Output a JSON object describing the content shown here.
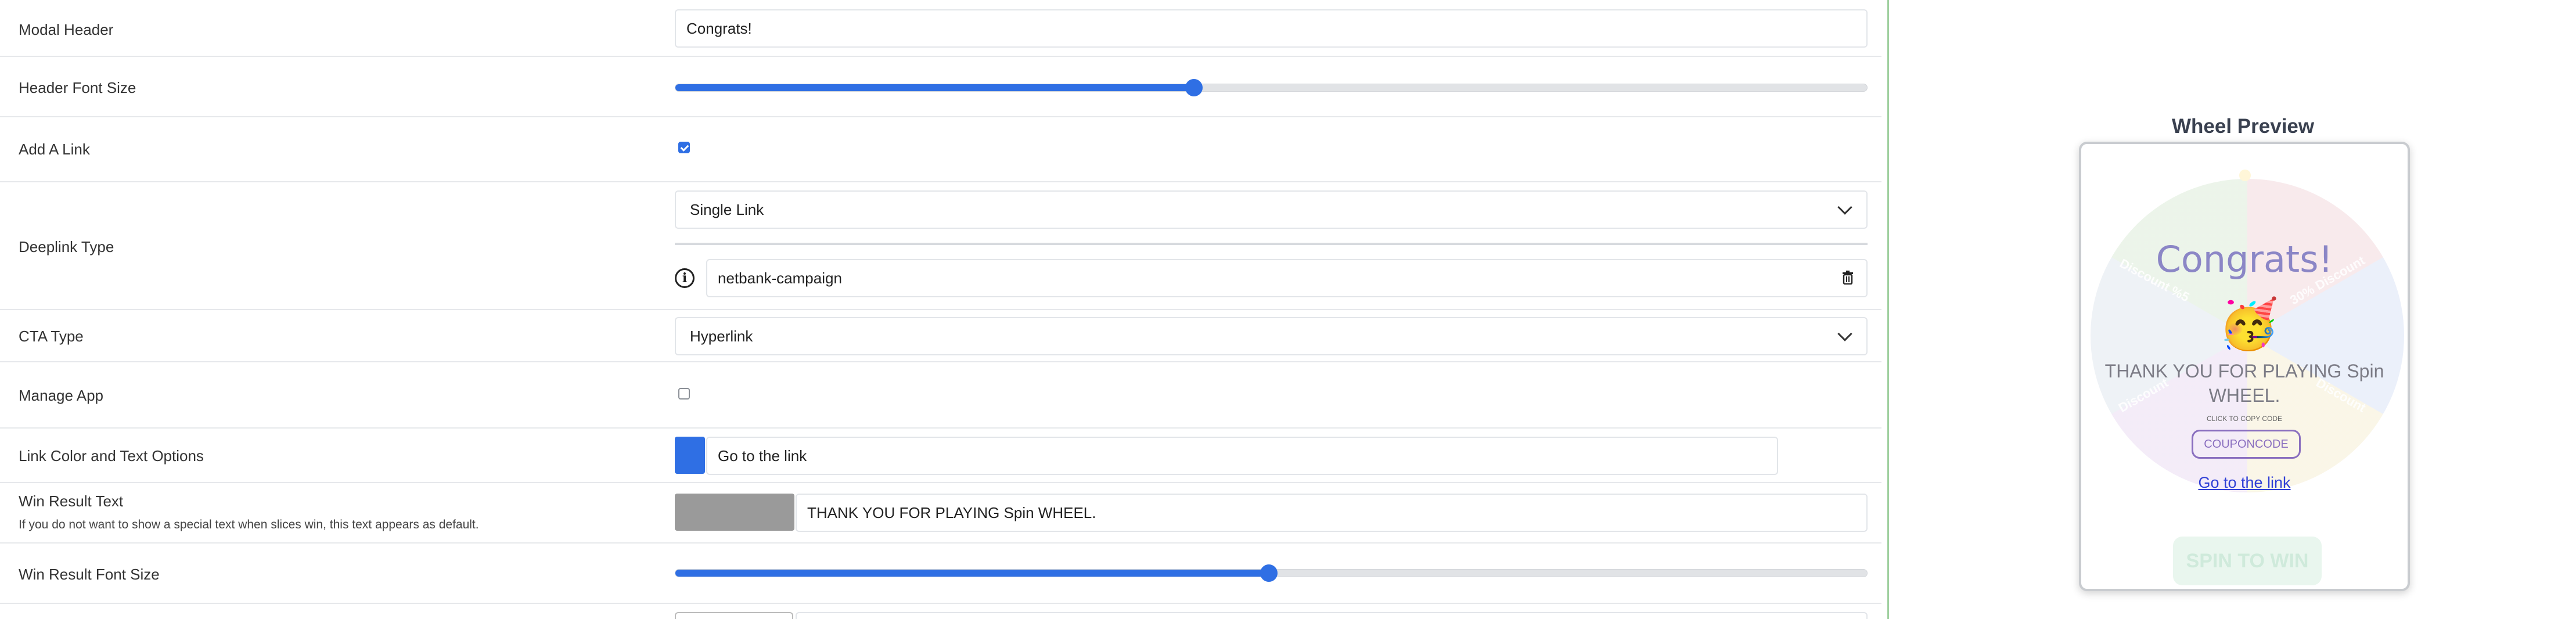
{
  "form": {
    "modal_header": {
      "label": "Modal Header",
      "value": "Congrats!"
    },
    "header_font_size": {
      "label": "Header Font Size",
      "level": 0.435
    },
    "add_link": {
      "label": "Add A Link",
      "checked": true
    },
    "deeplink_type": {
      "label": "Deeplink Type",
      "selected": "Single Link",
      "link_value": "netbank-campaign"
    },
    "cta_type": {
      "label": "CTA Type",
      "selected": "Hyperlink"
    },
    "manage_app": {
      "label": "Manage App",
      "checked": false
    },
    "link_color": {
      "label": "Link Color and Text Options",
      "color": "#2f6fe4",
      "text": "Go to the link"
    },
    "win_result_text": {
      "label": "Win Result Text",
      "hint": "If you do not want to show a special text when slices win, this text appears as default.",
      "color": "#9a9a9a",
      "value": "THANK YOU FOR PLAYING Spin WHEEL."
    },
    "win_result_font_size": {
      "label": "Win Result Font Size",
      "level": 0.498
    }
  },
  "preview": {
    "title": "Wheel Preview",
    "header": "Congrats!",
    "emoji": "🥳",
    "message": "THANK YOU FOR PLAYING Spin WHEEL.",
    "copy_hint": "CLICK TO COPY CODE",
    "coupon": "COUPONCODE",
    "link_text": "Go to the link",
    "spin_button": "SPIN TO WIN",
    "slice_labels": [
      "Discount %5",
      "30% Discount",
      "Discount",
      "Discount"
    ]
  },
  "colors": {
    "accent": "#2f6fe4",
    "divider": "#9fd09f",
    "link": "#2f3fd6"
  }
}
